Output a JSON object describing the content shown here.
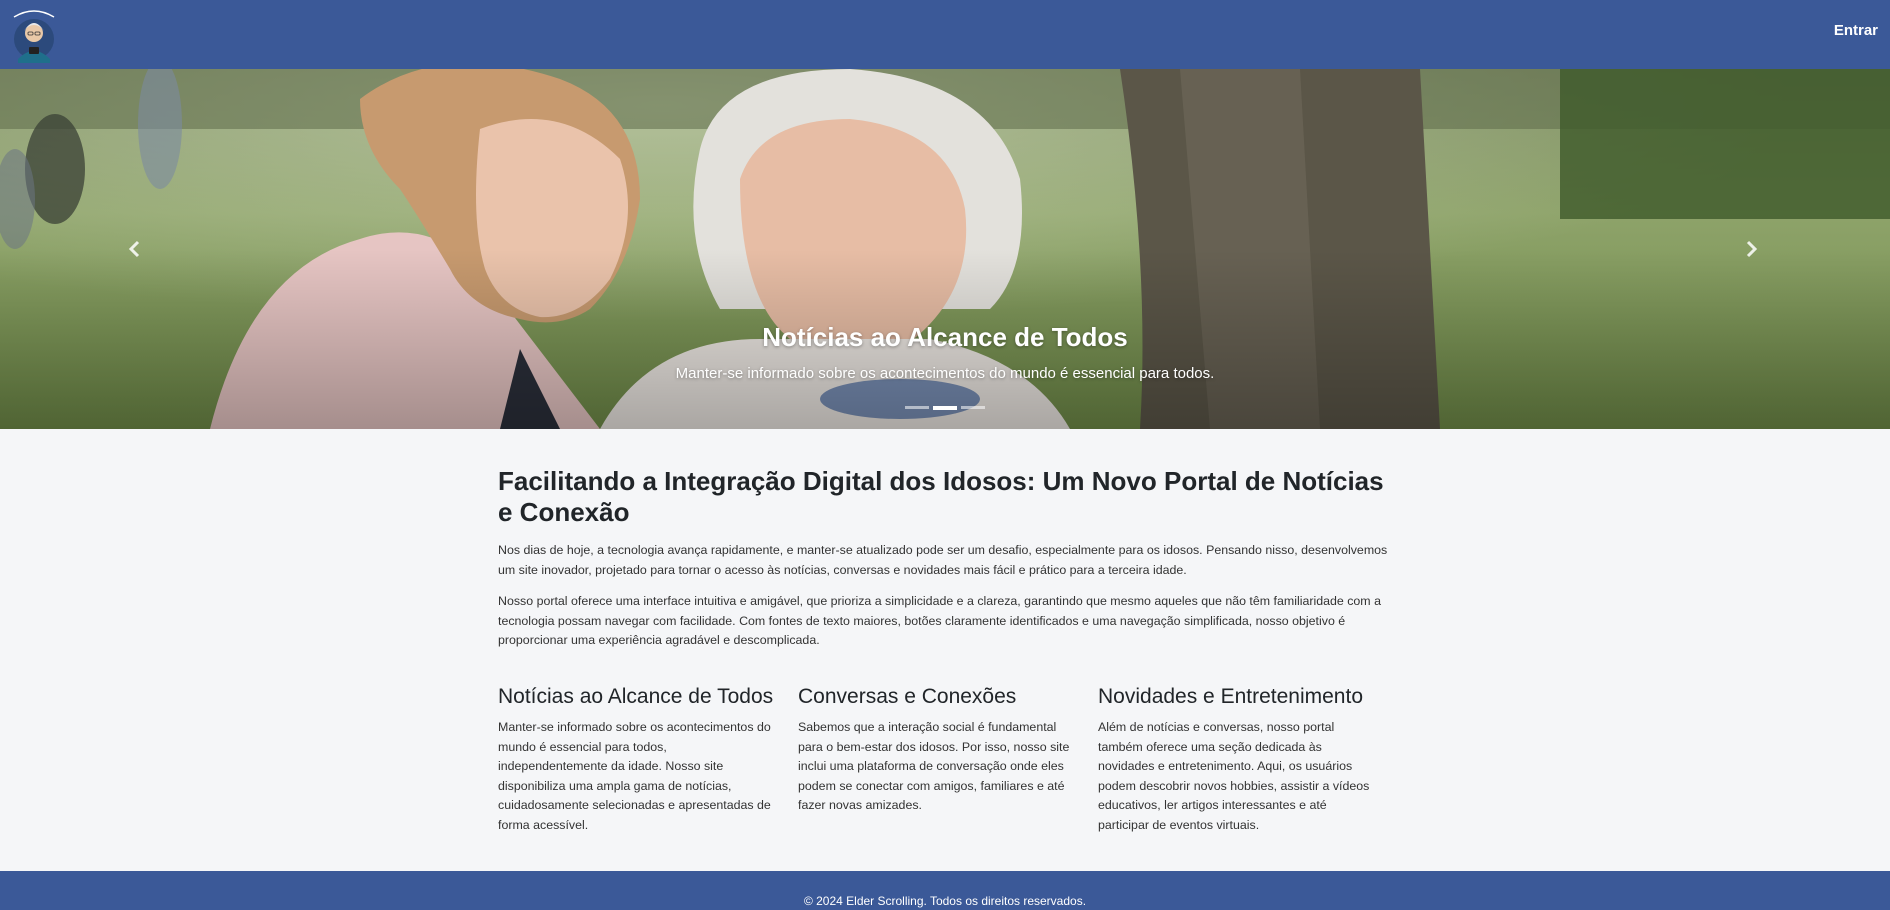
{
  "header": {
    "login_label": "Entrar",
    "brand_color": "#3b5998"
  },
  "carousel": {
    "caption_title": "Notícias ao Alcance de Todos",
    "caption_text": "Manter-se informado sobre os acontecimentos do mundo é essencial para todos.",
    "slide_count": 3,
    "active_slide": 2,
    "prev_icon": "chevron-left-icon",
    "next_icon": "chevron-right-icon"
  },
  "main": {
    "title": "Facilitando a Integração Digital dos Idosos: Um Novo Portal de Notícias e Conexão",
    "paragraphs": [
      "Nos dias de hoje, a tecnologia avança rapidamente, e manter-se atualizado pode ser um desafio, especialmente para os idosos. Pensando nisso, desenvolvemos um site inovador, projetado para tornar o acesso às notícias, conversas e novidades mais fácil e prático para a terceira idade.",
      "Nosso portal oferece uma interface intuitiva e amigável, que prioriza a simplicidade e a clareza, garantindo que mesmo aqueles que não têm familiaridade com a tecnologia possam navegar com facilidade. Com fontes de texto maiores, botões claramente identificados e uma navegação simplificada, nosso objetivo é proporcionar uma experiência agradável e descomplicada."
    ]
  },
  "features": [
    {
      "title": "Notícias ao Alcance de Todos",
      "text": "Manter-se informado sobre os acontecimentos do mundo é essencial para todos, independentemente da idade. Nosso site disponibiliza uma ampla gama de notícias, cuidadosamente selecionadas e apresentadas de forma acessível."
    },
    {
      "title": "Conversas e Conexões",
      "text": "Sabemos que a interação social é fundamental para o bem-estar dos idosos. Por isso, nosso site inclui uma plataforma de conversação onde eles podem se conectar com amigos, familiares e até fazer novas amizades."
    },
    {
      "title": "Novidades e Entretenimento",
      "text": "Além de notícias e conversas, nosso portal também oferece uma seção dedicada às novidades e entretenimento. Aqui, os usuários podem descobrir novos hobbies, assistir a vídeos educativos, ler artigos interessantes e até participar de eventos virtuais."
    }
  ],
  "footer": {
    "copyright": "© 2024 Elder Scrolling. Todos os direitos reservados."
  }
}
